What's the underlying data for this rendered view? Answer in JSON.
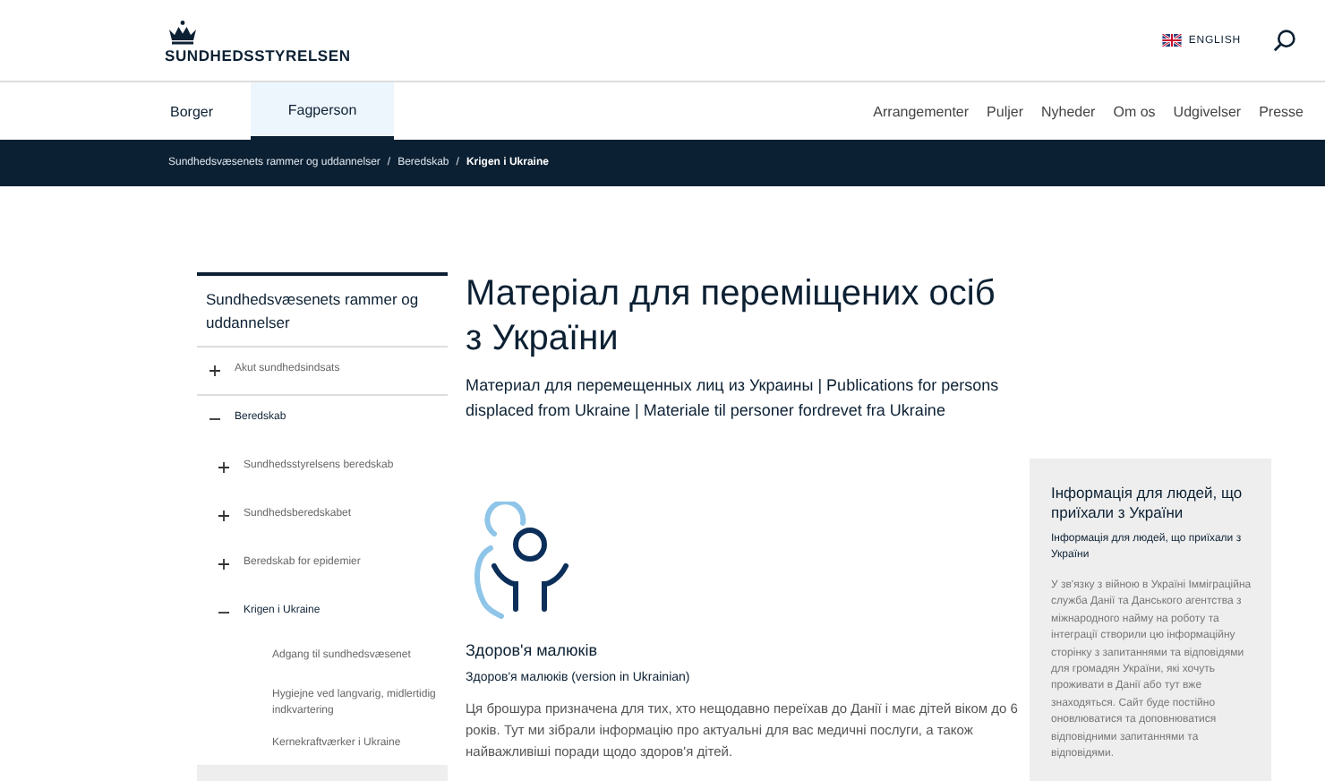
{
  "header": {
    "logo": "SUNDHEDSSTYRELSEN",
    "language": "ENGLISH"
  },
  "audience_tabs": [
    {
      "label": "Borger",
      "selected": false
    },
    {
      "label": "Fagperson",
      "selected": true
    }
  ],
  "nav_links": [
    "Arrangementer",
    "Puljer",
    "Nyheder",
    "Om os",
    "Udgivelser",
    "Presse"
  ],
  "breadcrumb": [
    {
      "label": "Sundhedsvæsenets rammer og uddannelser",
      "current": false
    },
    {
      "separator": "/",
      "label": "Beredskab",
      "current": false
    },
    {
      "separator": "/",
      "label": "Krigen i Ukraine",
      "current": true
    }
  ],
  "sidebar": {
    "title": "Sundhedsvæsenets rammer og uddannelser",
    "items": [
      {
        "label": "Akut sundhedsindsats",
        "expanded": false,
        "selected": false
      },
      {
        "label": "Beredskab",
        "expanded": true,
        "selected": false,
        "children": [
          {
            "label": "Sundhedsstyrelsens beredskab",
            "expanded": false,
            "selected": false
          },
          {
            "label": "Sundhedsberedskabet",
            "expanded": false,
            "selected": false
          },
          {
            "label": "Beredskab for epidemier",
            "expanded": false,
            "selected": false
          },
          {
            "label": "Krigen i Ukraine",
            "expanded": true,
            "selected": false,
            "children": [
              {
                "label": "Adgang til sundhedsvæsenet",
                "selected": false
              },
              {
                "label": "Hygiejne ved langvarig, midlertidig indkvartering",
                "selected": false
              },
              {
                "label": "Kernekraftværker i Ukraine",
                "selected": false
              },
              {
                "selected": true
              }
            ]
          }
        ]
      }
    ]
  },
  "page": {
    "title": "Матеріал для переміщених осіб з України",
    "subtitle": "Материал для перемещенных лиц из Украины | Publications for persons displaced from Ukraine | Materiale til personer fordrevet fra Ukraine"
  },
  "publication": {
    "title": "Здоров'я малюків",
    "subtitle": "Здоров'я малюків (version in Ukrainian)",
    "description": "Ця брошура призначена для тих, хто нещодавно переїхав до Данії і має дітей віком до 6 років. Тут ми зібрали інформацію про актуальні для вас медичні послуги, а також найважливіші поради щодо здоров'я дітей."
  },
  "info_box": {
    "title": "Інформація для людей, що приїхали з України",
    "subtitle": "Інформація для людей, що приїхали з України",
    "text": "У зв'язку з війною в Україні Імміграційна служба Данії та Данського агентства з міжнародного найму на роботу та інтеграції створили цю інформаційну сторінку з запитаннями та відповідями для громадян України, які хочуть проживати в Данії або тут вже знаходяться. Сайт буде постійно оновлюватися та доповнюватися відповідними запитаннями та відповідями."
  }
}
